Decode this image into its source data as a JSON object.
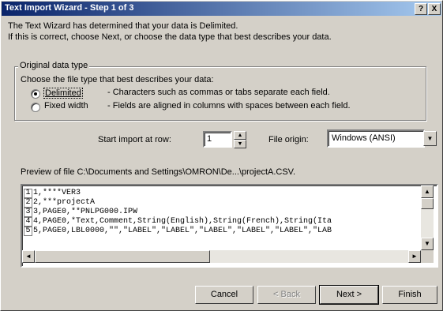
{
  "window": {
    "title": "Text Import Wizard - Step 1 of 3",
    "help_btn": "?",
    "close_btn": "X"
  },
  "intro": {
    "line1": "The Text Wizard has determined that your data is Delimited.",
    "line2": "If this is correct, choose Next, or choose the data type that best describes your data."
  },
  "original_data_type": {
    "legend": "Original data type",
    "prompt": "Choose the file type that best describes your data:",
    "options": [
      {
        "label": "Delimited",
        "desc": "- Characters such as commas or tabs separate each field.",
        "selected": true
      },
      {
        "label": "Fixed width",
        "desc": "- Fields are aligned in columns with spaces between each field.",
        "selected": false
      }
    ]
  },
  "start_import": {
    "label": "Start import at row:",
    "value": "1"
  },
  "file_origin": {
    "label": "File origin:",
    "value": "Windows (ANSI)"
  },
  "preview": {
    "label": "Preview of file C:\\Documents and Settings\\OMRON\\De...\\projectA.CSV.",
    "lines": [
      {
        "num": "1",
        "text": "1,****VER3"
      },
      {
        "num": "2",
        "text": "2,***projectA"
      },
      {
        "num": "3",
        "text": "3,PAGE0,**PNLPG000.IPW"
      },
      {
        "num": "4",
        "text": "4,PAGE0,*Text,Comment,String(English),String(French),String(Ita"
      },
      {
        "num": "5",
        "text": "5,PAGE0,LBL0000,\"\",\"LABEL\",\"LABEL\",\"LABEL\",\"LABEL\",\"LABEL\",\"LAB"
      }
    ]
  },
  "buttons": {
    "cancel": "Cancel",
    "back": "< Back",
    "next": "Next >",
    "finish": "Finish"
  },
  "icons": {
    "up": "▲",
    "down": "▼",
    "left": "◄",
    "right": "►"
  }
}
